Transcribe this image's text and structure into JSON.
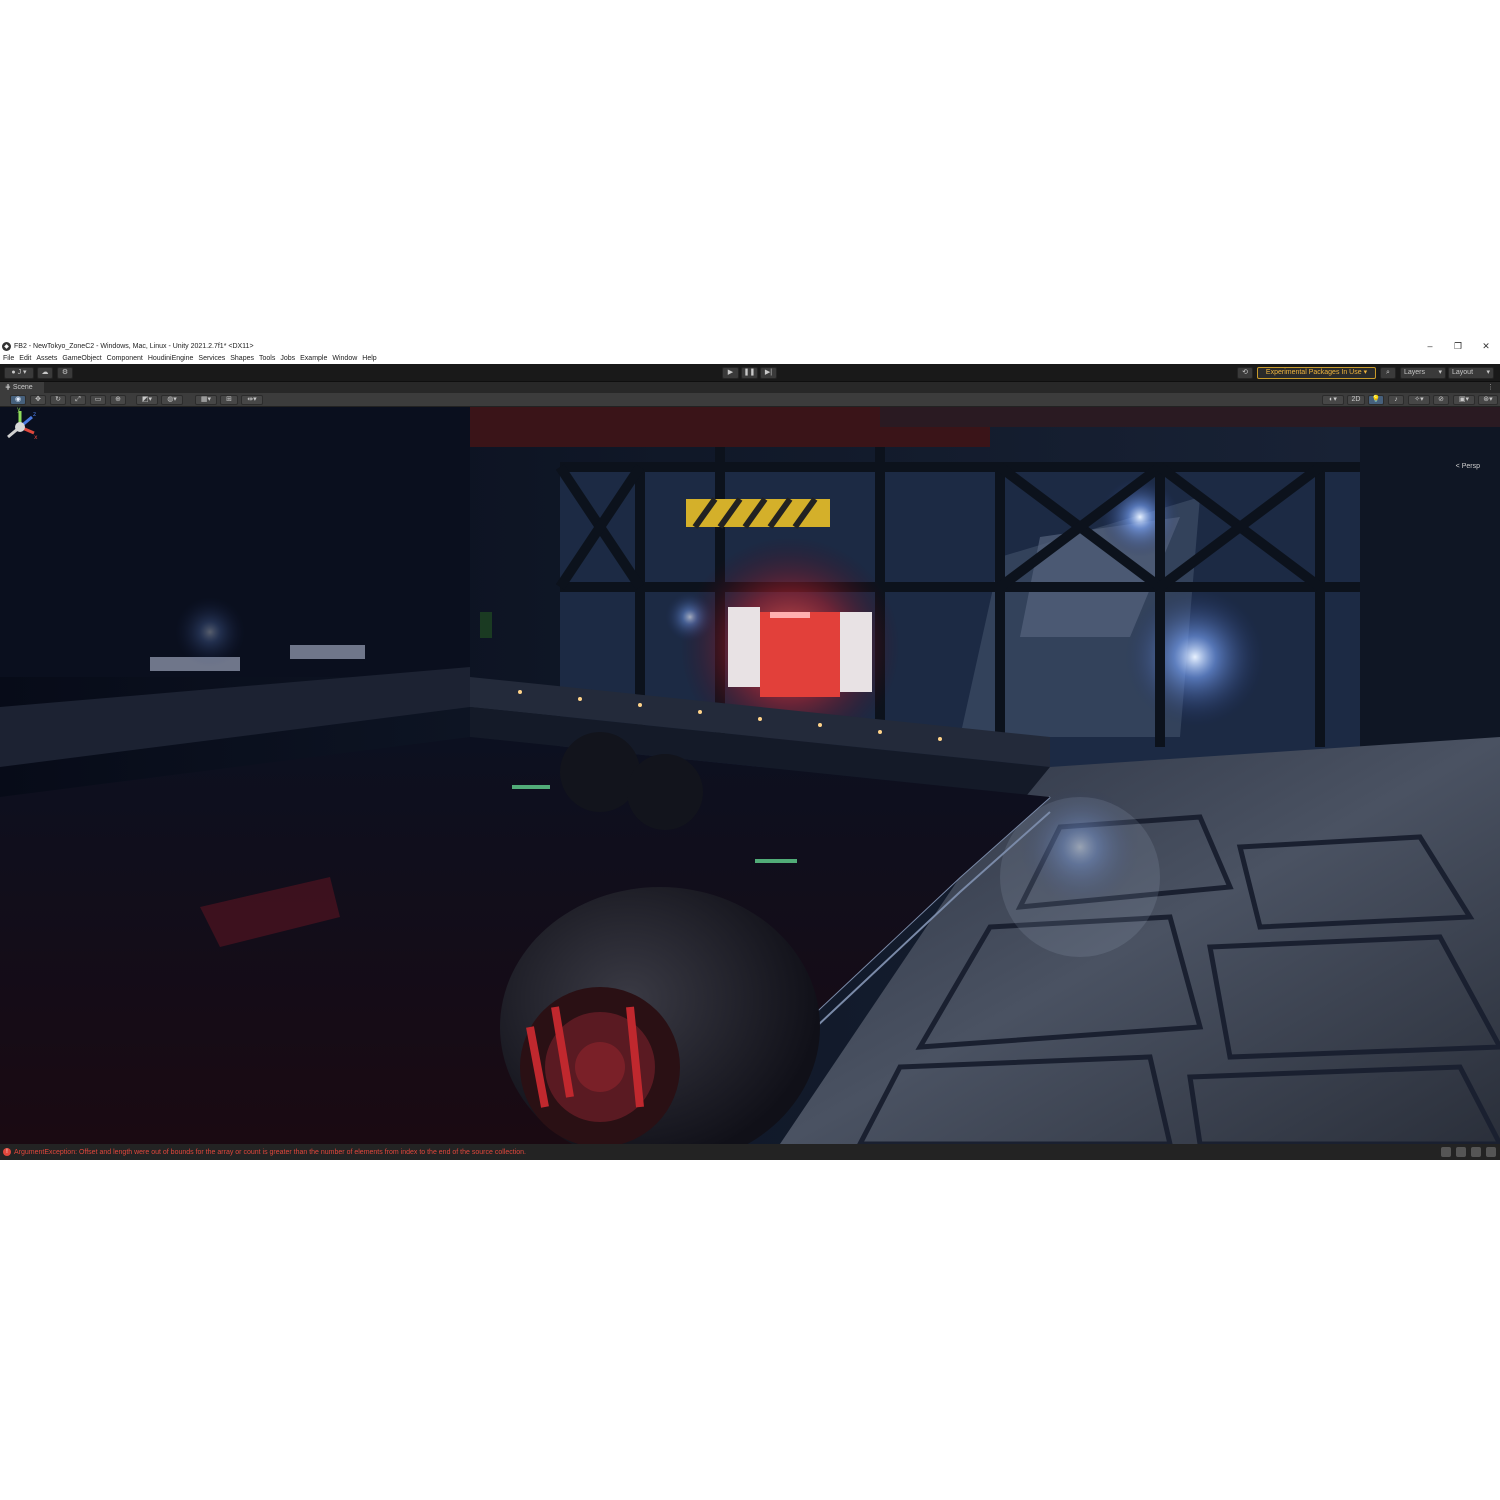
{
  "window": {
    "title": "FB2 - NewTokyo_ZoneC2 - Windows, Mac, Linux - Unity 2021.2.7f1* <DX11>",
    "controls": [
      "–",
      "❐",
      "✕"
    ]
  },
  "menu": [
    "File",
    "Edit",
    "Assets",
    "GameObject",
    "Component",
    "HoudiniEngine",
    "Services",
    "Shapes",
    "Tools",
    "Jobs",
    "Example",
    "Window",
    "Help"
  ],
  "toolbar": {
    "account_label": "J",
    "play_icon": "▶",
    "pause_icon": "❚❚",
    "step_icon": "▶|",
    "experimental_label": "Experimental Packages In Use ▾",
    "layers_label": "Layers",
    "layout_label": "Layout"
  },
  "scene": {
    "tab_label": "Scene",
    "mode_2d": "2D",
    "projection_label": "< Persp",
    "gizmo_axes": {
      "y": "y",
      "x": "x",
      "z": "z"
    }
  },
  "status": {
    "message": "ArgumentException: Offset and length were out of bounds for the array or count is greater than the number of elements from index to the end of the source collection.",
    "icon": "!"
  },
  "colors": {
    "accent": "#f0b43c",
    "error": "#e0473c",
    "door_glow": "#ff3a3a"
  }
}
